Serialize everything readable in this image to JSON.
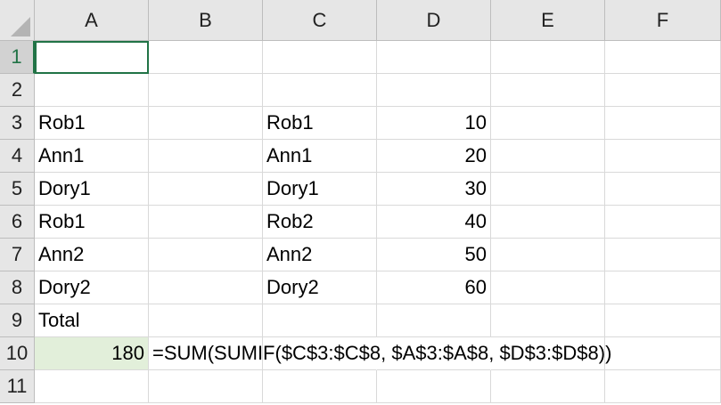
{
  "sheet": {
    "columns": [
      "A",
      "B",
      "C",
      "D",
      "E",
      "F"
    ],
    "rows": [
      "1",
      "2",
      "3",
      "4",
      "5",
      "6",
      "7",
      "8",
      "9",
      "10",
      "11"
    ],
    "active_row": "1",
    "active_cell": "A1",
    "cells": {
      "A3": "Rob1",
      "A4": "Ann1",
      "A5": "Dory1",
      "A6": "Rob1",
      "A7": "Ann2",
      "A8": "Dory2",
      "A9": "Total",
      "A10": "180",
      "B10": "=SUM(SUMIF($C$3:$C$8, $A$3:$A$8, $D$3:$D$8))",
      "C3": "Rob1",
      "C4": "Ann1",
      "C5": "Dory1",
      "C6": "Rob2",
      "C7": "Ann2",
      "C8": "Dory2",
      "D3": "10",
      "D4": "20",
      "D5": "30",
      "D6": "40",
      "D7": "50",
      "D8": "60"
    },
    "highlight_fill": "#e2efda",
    "selection_color": "#217346"
  }
}
